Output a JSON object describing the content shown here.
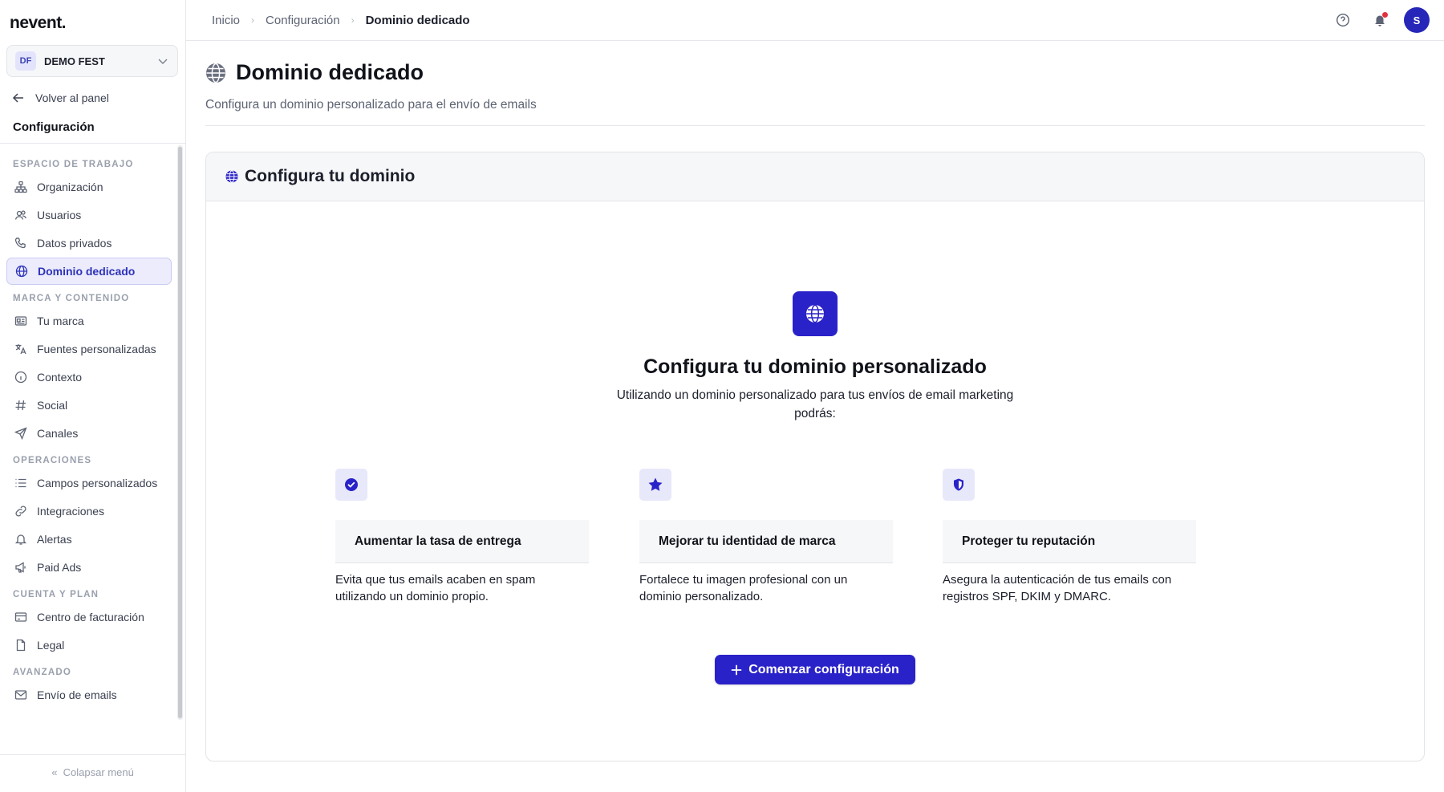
{
  "app": {
    "logo": "nevent."
  },
  "org": {
    "initials": "DF",
    "name": "DEMO FEST"
  },
  "sidebar": {
    "back_label": "Volver al panel",
    "title": "Configuración",
    "sections": [
      {
        "label": "ESPACIO DE TRABAJO",
        "items": [
          {
            "label": "Organización",
            "icon": "org-chart-icon"
          },
          {
            "label": "Usuarios",
            "icon": "users-icon"
          },
          {
            "label": "Datos privados",
            "icon": "phone-icon"
          },
          {
            "label": "Dominio dedicado",
            "icon": "globe-icon",
            "active": true
          }
        ]
      },
      {
        "label": "MARCA Y CONTENIDO",
        "items": [
          {
            "label": "Tu marca",
            "icon": "id-card-icon"
          },
          {
            "label": "Fuentes personalizadas",
            "icon": "translate-icon"
          },
          {
            "label": "Contexto",
            "icon": "info-icon"
          },
          {
            "label": "Social",
            "icon": "hash-icon"
          },
          {
            "label": "Canales",
            "icon": "send-icon"
          }
        ]
      },
      {
        "label": "OPERACIONES",
        "items": [
          {
            "label": "Campos personalizados",
            "icon": "list-icon"
          },
          {
            "label": "Integraciones",
            "icon": "link-icon"
          },
          {
            "label": "Alertas",
            "icon": "bell-icon"
          },
          {
            "label": "Paid Ads",
            "icon": "megaphone-icon"
          }
        ]
      },
      {
        "label": "CUENTA Y PLAN",
        "items": [
          {
            "label": "Centro de facturación",
            "icon": "credit-card-icon"
          },
          {
            "label": "Legal",
            "icon": "document-icon"
          }
        ]
      },
      {
        "label": "AVANZADO",
        "items": [
          {
            "label": "Envío de emails",
            "icon": "mail-icon"
          }
        ]
      }
    ],
    "collapse_label": "Colapsar menú"
  },
  "breadcrumb": [
    "Inicio",
    "Configuración",
    "Dominio dedicado"
  ],
  "user": {
    "initial": "S"
  },
  "page": {
    "title": "Dominio dedicado",
    "subtitle": "Configura un dominio personalizado para el envío de emails"
  },
  "card": {
    "title": "Configura tu dominio",
    "hero_title": "Configura tu dominio personalizado",
    "hero_description": "Utilizando un dominio personalizado para tus envíos de email marketing podrás:",
    "features": [
      {
        "icon": "check-badge-icon",
        "title": "Aumentar la tasa de entrega",
        "description": "Evita que tus emails acaben en spam utilizando un dominio propio."
      },
      {
        "icon": "star-icon",
        "title": "Mejorar tu identidad de marca",
        "description": "Fortalece tu imagen profesional con un dominio personalizado."
      },
      {
        "icon": "shield-icon",
        "title": "Proteger tu reputación",
        "description": "Asegura la autenticación de tus emails con registros SPF, DKIM y DMARC."
      }
    ],
    "cta_label": "Comenzar configuración"
  },
  "colors": {
    "accent": "#2a22c9",
    "active_bg": "#ececfc",
    "notification": "#e0323e"
  }
}
